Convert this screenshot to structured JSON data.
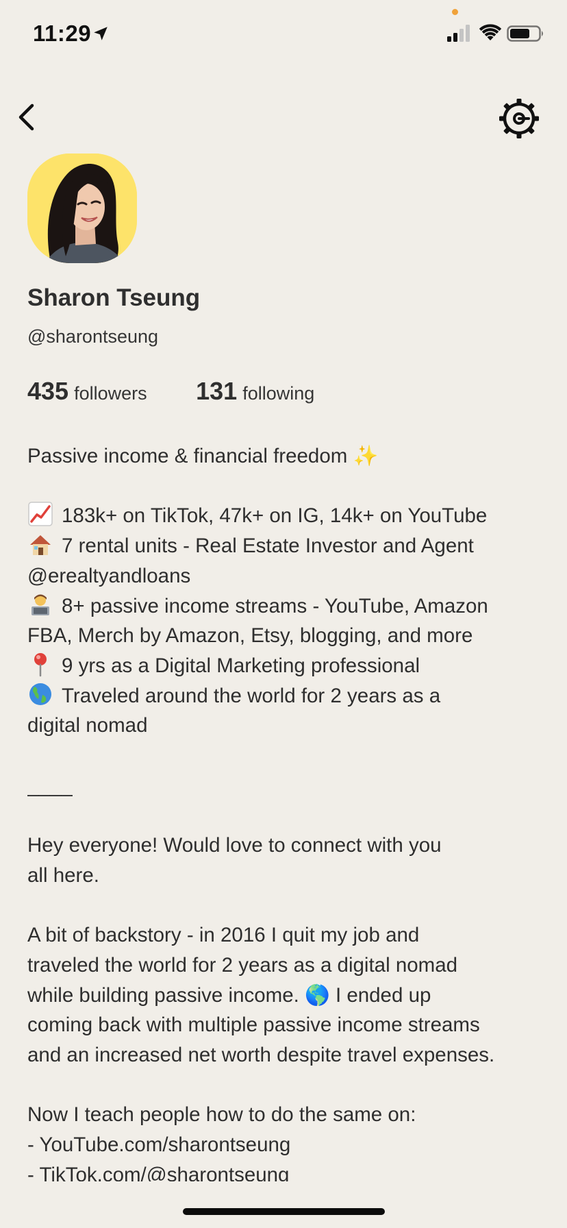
{
  "status_bar": {
    "time": "11:29",
    "icons": [
      "location-arrow-icon",
      "cellular-signal-icon",
      "wifi-icon",
      "battery-icon"
    ]
  },
  "nav": {
    "back_icon": "chevron-left-icon",
    "settings_icon": "gear-icon"
  },
  "profile": {
    "name": "Sharon Tseung",
    "handle": "@sharontseung",
    "followers_count": "435",
    "followers_label": "followers",
    "following_count": "131",
    "following_label": "following"
  },
  "bio": {
    "lines": [
      {
        "text": "Passive income & financial freedom ✨"
      },
      {
        "text": ""
      },
      {
        "icon": "chart-increasing-emoji",
        "text": "183k+ on TikTok, 47k+ on IG, 14k+ on YouTube"
      },
      {
        "icon": "house-emoji",
        "text": "7 rental units - Real Estate Investor and Agent"
      },
      {
        "text": "@erealtyandloans"
      },
      {
        "icon": "technologist-emoji",
        "text": "8+ passive income streams - YouTube, Amazon"
      },
      {
        "text": "FBA, Merch by Amazon, Etsy, blogging, and more"
      },
      {
        "icon": "round-pushpin-emoji",
        "text": "9 yrs as a Digital Marketing professional"
      },
      {
        "icon": "globe-americas-emoji",
        "text": "Traveled around the world for 2 years as a"
      },
      {
        "text": "digital nomad"
      },
      {
        "text": ""
      },
      {
        "text": "____"
      },
      {
        "text": ""
      },
      {
        "text": "Hey everyone! Would love to connect with you"
      },
      {
        "text": "all here."
      },
      {
        "text": ""
      },
      {
        "text": "A bit of backstory - in 2016 I quit my job and"
      },
      {
        "text": "traveled the world for 2 years as a digital nomad"
      },
      {
        "text": "while building passive income. 🌎 I ended up"
      },
      {
        "text": "coming back with multiple passive income streams"
      },
      {
        "text": "and an increased net worth despite travel expenses."
      },
      {
        "text": ""
      },
      {
        "text": "Now I teach people how to do the same on:"
      },
      {
        "text": "- YouTube.com/sharontseung"
      },
      {
        "text": "- TikTok.com/@sharontseung"
      }
    ]
  },
  "colors": {
    "background": "#f1eee8",
    "avatar_bg": "#fde36a",
    "text": "#2e2e2e",
    "status_dot": "#f0a23a"
  }
}
